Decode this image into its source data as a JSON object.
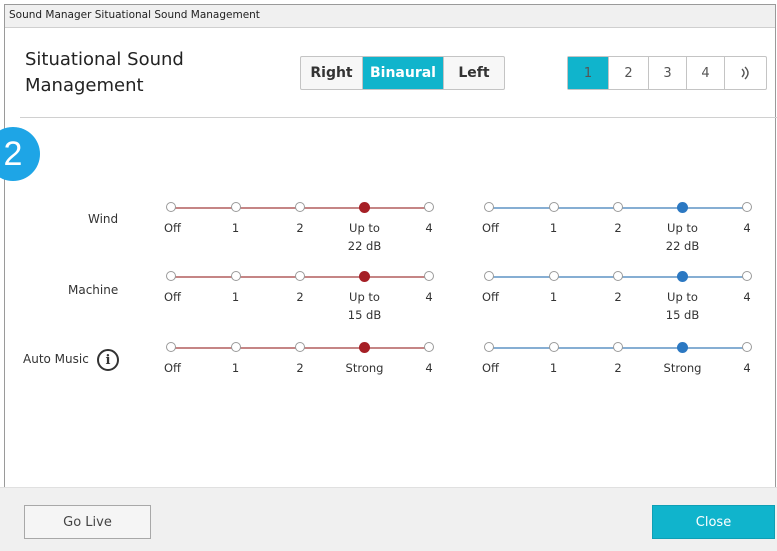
{
  "window": {
    "title": "Sound Manager Situational Sound Management"
  },
  "heading": {
    "line1": "Situational Sound",
    "line2": "Management"
  },
  "side_selector": {
    "options": [
      "Right",
      "Binaural",
      "Left"
    ],
    "selected": "Binaural"
  },
  "program_selector": {
    "options": [
      "1",
      "2",
      "3",
      "4"
    ],
    "selected": "1",
    "icon": "streaming-icon"
  },
  "step_badge": "2",
  "colors": {
    "accent": "#10b4cc",
    "right_track": "#c58585",
    "right_dot": "#a51f26",
    "left_track": "#86aed3",
    "left_dot": "#2b78c2",
    "badge": "#1ea5e6"
  },
  "rows": [
    {
      "label": "Wind",
      "steps": [
        "Off",
        "1",
        "2",
        "Up to\n22 dB",
        "4"
      ],
      "right_level": 3,
      "left_level": 3
    },
    {
      "label": "Machine",
      "steps": [
        "Off",
        "1",
        "2",
        "Up to\n15 dB",
        "4"
      ],
      "right_level": 3,
      "left_level": 3
    },
    {
      "label": "Auto Music",
      "steps": [
        "Off",
        "1",
        "2",
        "Strong",
        "4"
      ],
      "right_level": 3,
      "left_level": 3,
      "info_icon": "i"
    }
  ],
  "footer": {
    "go_live": "Go Live",
    "close": "Close"
  }
}
